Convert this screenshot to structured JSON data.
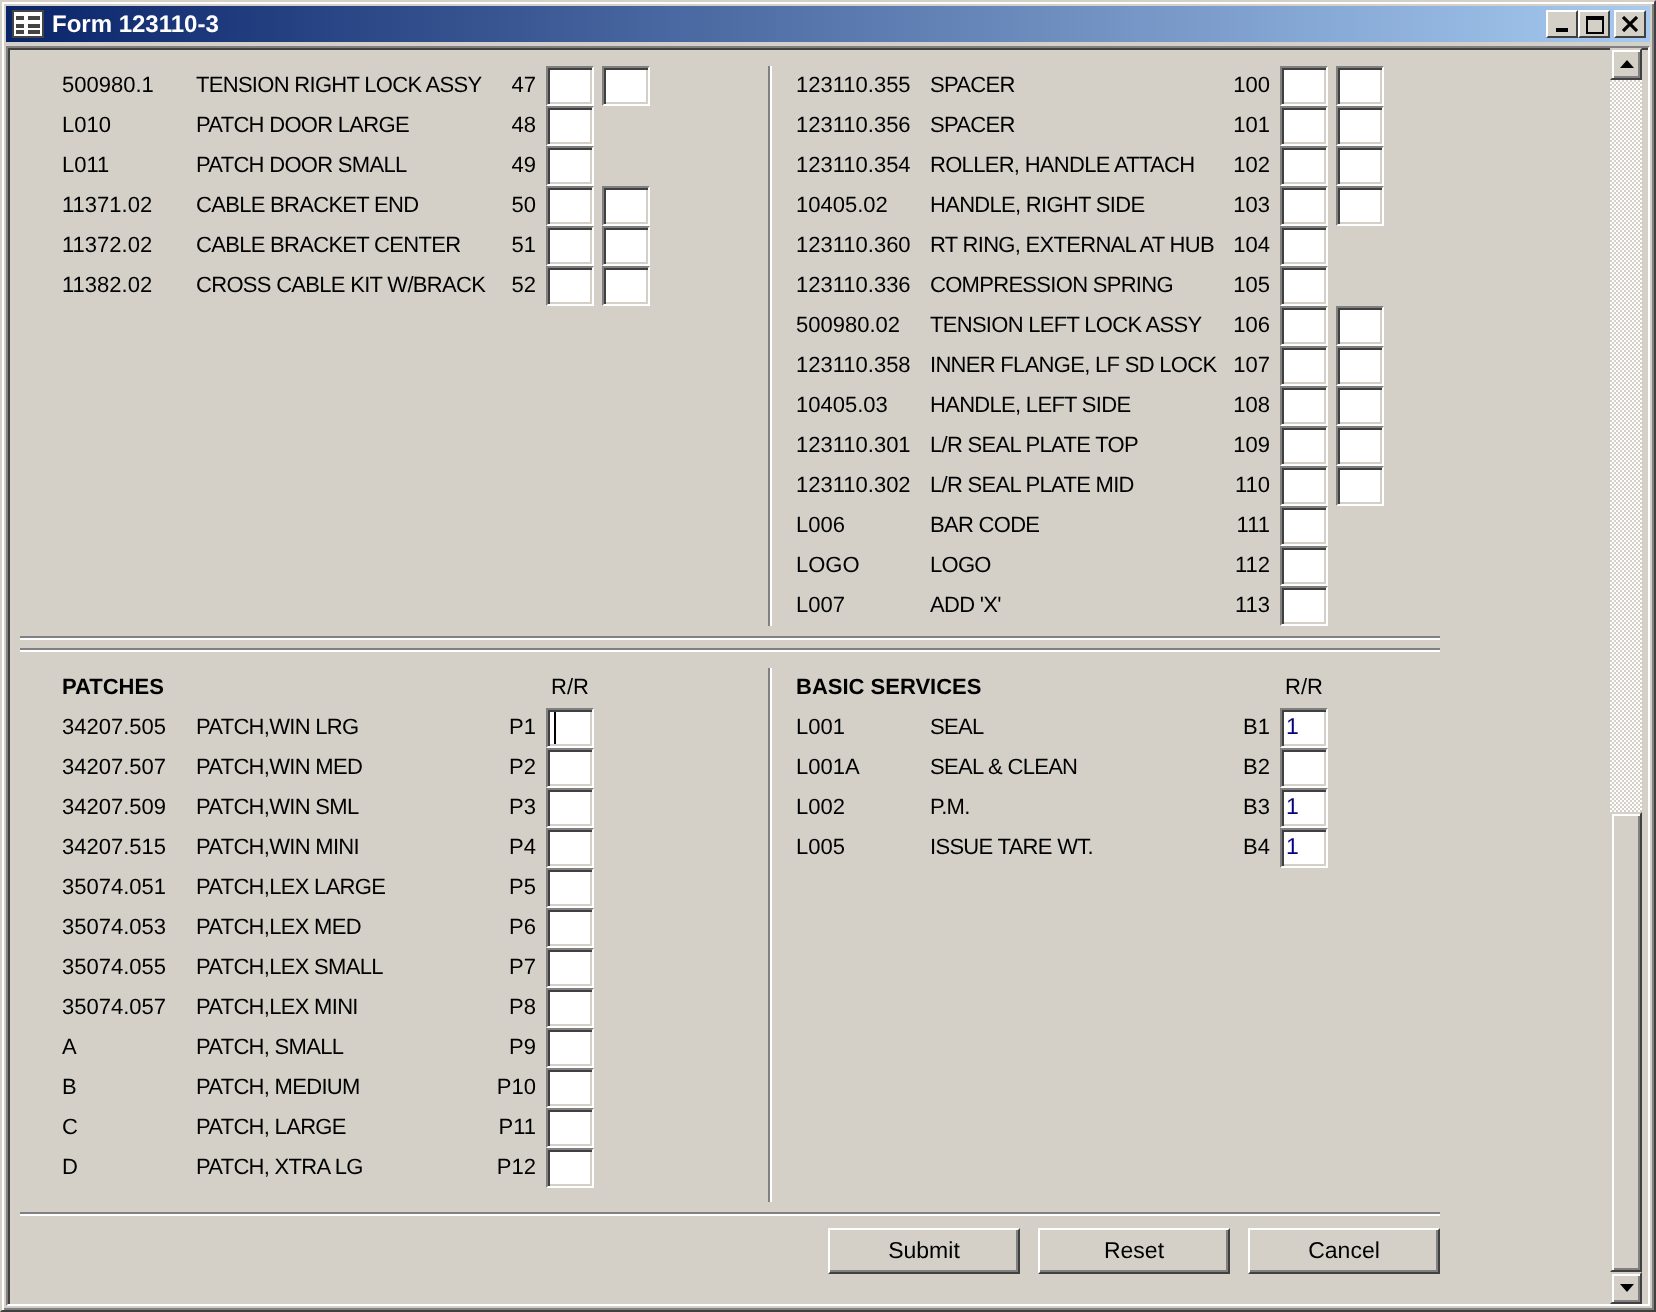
{
  "window": {
    "title": "Form 123110-3"
  },
  "parts_left": [
    {
      "code": "500980.1",
      "description": "TENSION RIGHT LOCK ASSY",
      "number": "47",
      "kind": "double"
    },
    {
      "code": "L010",
      "description": "PATCH DOOR LARGE",
      "number": "48",
      "kind": "single"
    },
    {
      "code": "L011",
      "description": "PATCH DOOR SMALL",
      "number": "49",
      "kind": "single"
    },
    {
      "code": "11371.02",
      "description": "CABLE BRACKET END",
      "number": "50",
      "kind": "double"
    },
    {
      "code": "11372.02",
      "description": "CABLE BRACKET CENTER",
      "number": "51",
      "kind": "double"
    },
    {
      "code": "11382.02",
      "description": "CROSS CABLE KIT W/BRACK",
      "number": "52",
      "kind": "double"
    }
  ],
  "parts_right": [
    {
      "code": "123110.355",
      "description": "SPACER",
      "number": "100",
      "kind": "double"
    },
    {
      "code": "123110.356",
      "description": "SPACER",
      "number": "101",
      "kind": "double"
    },
    {
      "code": "123110.354",
      "description": "ROLLER, HANDLE ATTACH",
      "number": "102",
      "kind": "double"
    },
    {
      "code": "10405.02",
      "description": "HANDLE, RIGHT SIDE",
      "number": "103",
      "kind": "double"
    },
    {
      "code": "123110.360",
      "description": "RT RING, EXTERNAL AT HUB",
      "number": "104",
      "kind": "single"
    },
    {
      "code": "123110.336",
      "description": "COMPRESSION SPRING",
      "number": "105",
      "kind": "single"
    },
    {
      "code": "500980.02",
      "description": "TENSION LEFT LOCK ASSY",
      "number": "106",
      "kind": "double"
    },
    {
      "code": "123110.358",
      "description": "INNER FLANGE, LF SD LOCK",
      "number": "107",
      "kind": "double"
    },
    {
      "code": "10405.03",
      "description": "HANDLE, LEFT SIDE",
      "number": "108",
      "kind": "double"
    },
    {
      "code": "123110.301",
      "description": "L/R SEAL PLATE TOP",
      "number": "109",
      "kind": "double"
    },
    {
      "code": "123110.302",
      "description": "L/R SEAL PLATE MID",
      "number": "110",
      "kind": "double"
    },
    {
      "code": "L006",
      "description": "BAR CODE",
      "number": "111",
      "kind": "single"
    },
    {
      "code": "LOGO",
      "description": "LOGO",
      "number": "112",
      "kind": "single"
    },
    {
      "code": "L007",
      "description": "ADD 'X'",
      "number": "113",
      "kind": "single"
    }
  ],
  "patches": {
    "title": "PATCHES",
    "column_label": "R/R",
    "rows": [
      {
        "code": "34207.505",
        "description": "PATCH,WIN LRG",
        "number": "P1",
        "focused": true
      },
      {
        "code": "34207.507",
        "description": "PATCH,WIN MED",
        "number": "P2",
        "focused": false
      },
      {
        "code": "34207.509",
        "description": "PATCH,WIN SML",
        "number": "P3",
        "focused": false
      },
      {
        "code": "34207.515",
        "description": "PATCH,WIN MINI",
        "number": "P4",
        "focused": false
      },
      {
        "code": "35074.051",
        "description": "PATCH,LEX LARGE",
        "number": "P5",
        "focused": false
      },
      {
        "code": "35074.053",
        "description": "PATCH,LEX MED",
        "number": "P6",
        "focused": false
      },
      {
        "code": "35074.055",
        "description": "PATCH,LEX SMALL",
        "number": "P7",
        "focused": false
      },
      {
        "code": "35074.057",
        "description": "PATCH,LEX MINI",
        "number": "P8",
        "focused": false
      },
      {
        "code": "A",
        "description": "PATCH, SMALL",
        "number": "P9",
        "focused": false
      },
      {
        "code": "B",
        "description": "PATCH, MEDIUM",
        "number": "P10",
        "focused": false
      },
      {
        "code": "C",
        "description": "PATCH, LARGE",
        "number": "P11",
        "focused": false
      },
      {
        "code": "D",
        "description": "PATCH, XTRA LG",
        "number": "P12",
        "focused": false
      }
    ]
  },
  "basic_services": {
    "title": "BASIC SERVICES",
    "column_label": "R/R",
    "rows": [
      {
        "code": "L001",
        "description": "SEAL",
        "number": "B1",
        "value": "1"
      },
      {
        "code": "L001A",
        "description": "SEAL & CLEAN",
        "number": "B2"
      },
      {
        "code": "L002",
        "description": "P.M.",
        "number": "B3",
        "value": "1"
      },
      {
        "code": "L005",
        "description": "ISSUE TARE WT.",
        "number": "B4",
        "value": "1"
      }
    ]
  },
  "buttons": [
    "Submit",
    "Reset",
    "Cancel"
  ]
}
